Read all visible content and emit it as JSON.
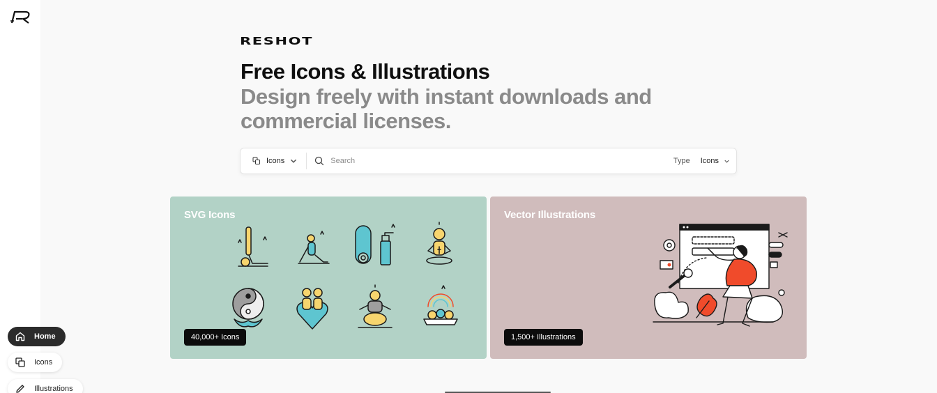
{
  "sidebar": {
    "logo_icon": "reshot-r-logo-icon",
    "nav": [
      {
        "label": "Home",
        "icon": "home-icon",
        "active": true
      },
      {
        "label": "Icons",
        "icon": "icons-icon",
        "active": false
      },
      {
        "label": "Illustrations",
        "icon": "pencil-icon",
        "active": false
      }
    ]
  },
  "hero": {
    "brand": "RESHOT",
    "headline": "Free Icons & Illustrations",
    "subline": "Design freely with instant downloads and commercial licenses."
  },
  "search": {
    "asset_type_value": "Icons",
    "placeholder": "Search",
    "type_label": "Type",
    "type_value": "Icons"
  },
  "cards": [
    {
      "title": "SVG Icons",
      "badge": "40,000+ Icons",
      "bg_color": "#b2d2c6"
    },
    {
      "title": "Vector Illustrations",
      "badge": "1,500+ Illustrations",
      "bg_color": "#d0bcbc"
    }
  ],
  "colors": {
    "accent_red": "#f04b2b",
    "icon_yellow": "#f7d56e",
    "icon_teal": "#5ec5d0"
  }
}
